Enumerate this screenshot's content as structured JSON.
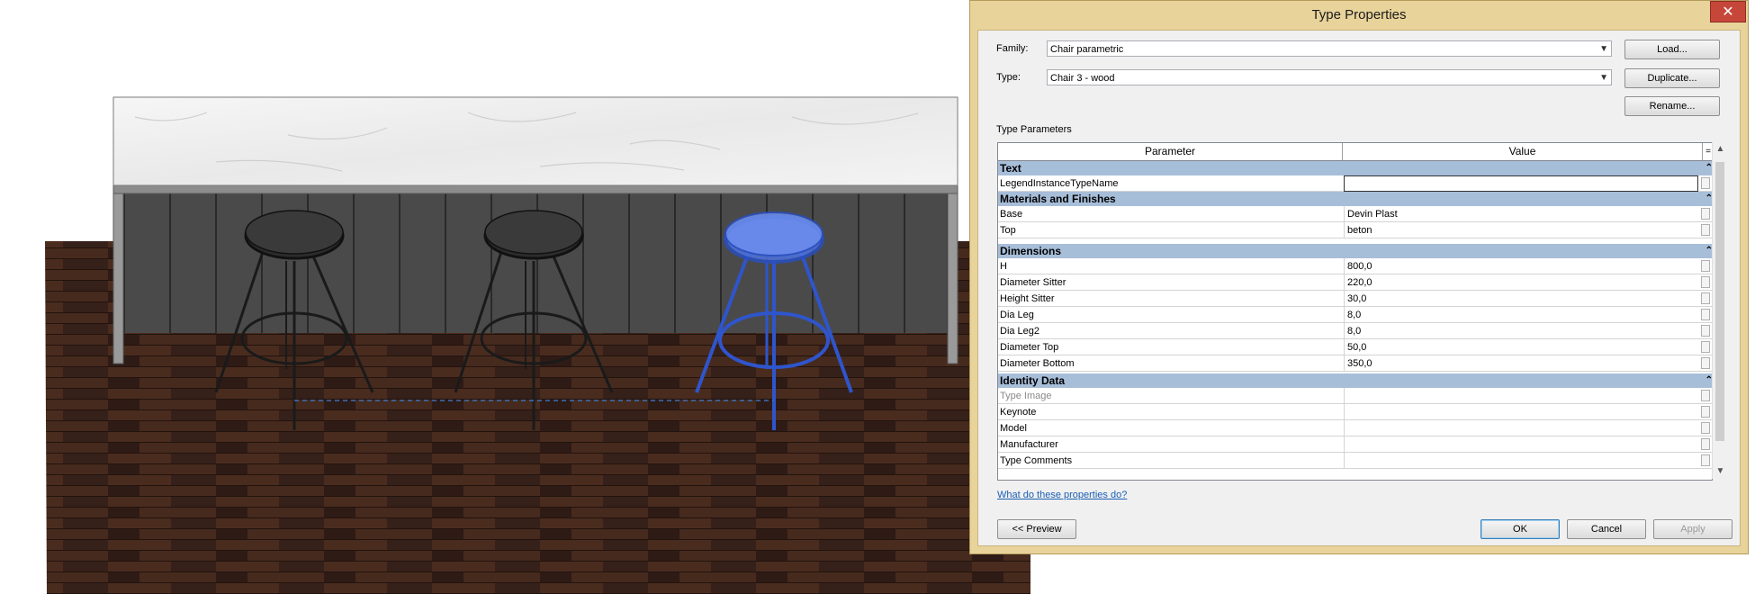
{
  "dialog": {
    "title": "Type Properties",
    "close_glyph": "✕",
    "family_label": "Family:",
    "family_value": "Chair parametric",
    "type_label": "Type:",
    "type_value": "Chair 3 - wood",
    "load_label": "Load...",
    "duplicate_label": "Duplicate...",
    "rename_label": "Rename...",
    "type_parameters_label": "Type Parameters",
    "header_parameter": "Parameter",
    "header_value": "Value",
    "header_menu_glyph": "=",
    "help_link": "What do these properties do?",
    "preview_label": "<< Preview",
    "ok_label": "OK",
    "cancel_label": "Cancel",
    "apply_label": "Apply",
    "groups": [
      {
        "name": "Text",
        "rows": [
          {
            "name": "LegendInstanceTypeName",
            "value": ""
          }
        ]
      },
      {
        "name": "Materials and Finishes",
        "rows": [
          {
            "name": "Base",
            "value": "Devin Plast"
          },
          {
            "name": "Top",
            "value": "beton"
          }
        ]
      },
      {
        "name": "Dimensions",
        "rows": [
          {
            "name": "H",
            "value": "800,0"
          },
          {
            "name": "Diameter Sitter",
            "value": "220,0"
          },
          {
            "name": "Height Sitter",
            "value": "30,0"
          },
          {
            "name": "Dia Leg",
            "value": "8,0"
          },
          {
            "name": "Dia Leg2",
            "value": "8,0"
          },
          {
            "name": "Diameter Top",
            "value": "50,0"
          },
          {
            "name": "Diameter Bottom",
            "value": "350,0"
          }
        ]
      },
      {
        "name": "Identity Data",
        "rows": [
          {
            "name": "Type Image",
            "value": ""
          },
          {
            "name": "Keynote",
            "value": ""
          },
          {
            "name": "Model",
            "value": ""
          },
          {
            "name": "Manufacturer",
            "value": ""
          },
          {
            "name": "Type Comments",
            "value": ""
          }
        ]
      }
    ]
  },
  "colors": {
    "dialog_frame": "#e8d39a",
    "group_header": "#a7bed9",
    "selected_stool": "#3b63d6",
    "floor": "#3d2419",
    "counter_panels": "#4a4a4a"
  }
}
